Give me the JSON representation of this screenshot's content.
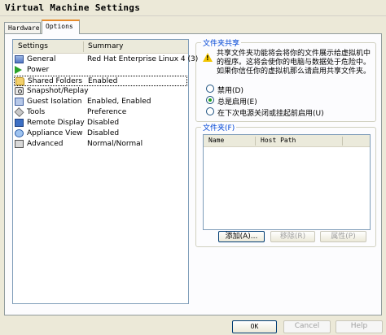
{
  "window": {
    "title": "Virtual Machine Settings"
  },
  "tabs": [
    {
      "label": "Hardware"
    },
    {
      "label": "Options"
    }
  ],
  "settings_list": {
    "headers": {
      "settings": "Settings",
      "summary": "Summary"
    },
    "selected": "Shared Folders",
    "items": [
      {
        "name": "General",
        "summary": "Red Hat Enterprise Linux 4 (3)",
        "icon": "general-icon"
      },
      {
        "name": "Power",
        "summary": "",
        "icon": "power-icon"
      },
      {
        "name": "Shared Folders",
        "summary": "Enabled",
        "icon": "folder-icon"
      },
      {
        "name": "Snapshot/Replay",
        "summary": "",
        "icon": "snapshot-icon"
      },
      {
        "name": "Guest Isolation",
        "summary": "Enabled, Enabled",
        "icon": "guest-isolation-icon"
      },
      {
        "name": "Tools",
        "summary": "Preference",
        "icon": "tools-icon"
      },
      {
        "name": "Remote Display",
        "summary": "Disabled",
        "icon": "remote-display-icon"
      },
      {
        "name": "Appliance View",
        "summary": "Disabled",
        "icon": "appliance-view-icon"
      },
      {
        "name": "Advanced",
        "summary": "Normal/Normal",
        "icon": "advanced-icon"
      }
    ]
  },
  "sharing_group": {
    "title": "文件夹共享",
    "warning": "共享文件夹功能将会将你的文件展示给虚拟机中的程序。这将会使你的电脑与数据处于危险中。如果你信任你的虚拟机那么请启用共享文件夹。",
    "options": [
      {
        "label": "禁用(D)",
        "checked": false
      },
      {
        "label": "总是启用(E)",
        "checked": true
      },
      {
        "label": "在下次电源关闭或挂起前启用(U)",
        "checked": false
      }
    ]
  },
  "folders_group": {
    "title": "文件夹(F)",
    "columns": {
      "name": "Name",
      "host_path": "Host Path"
    },
    "buttons": {
      "add": "添加(A)...",
      "remove": "移除(R)",
      "properties": "属性(P)"
    }
  },
  "dialog_buttons": {
    "ok": "OK",
    "cancel": "Cancel",
    "help": "Help"
  }
}
